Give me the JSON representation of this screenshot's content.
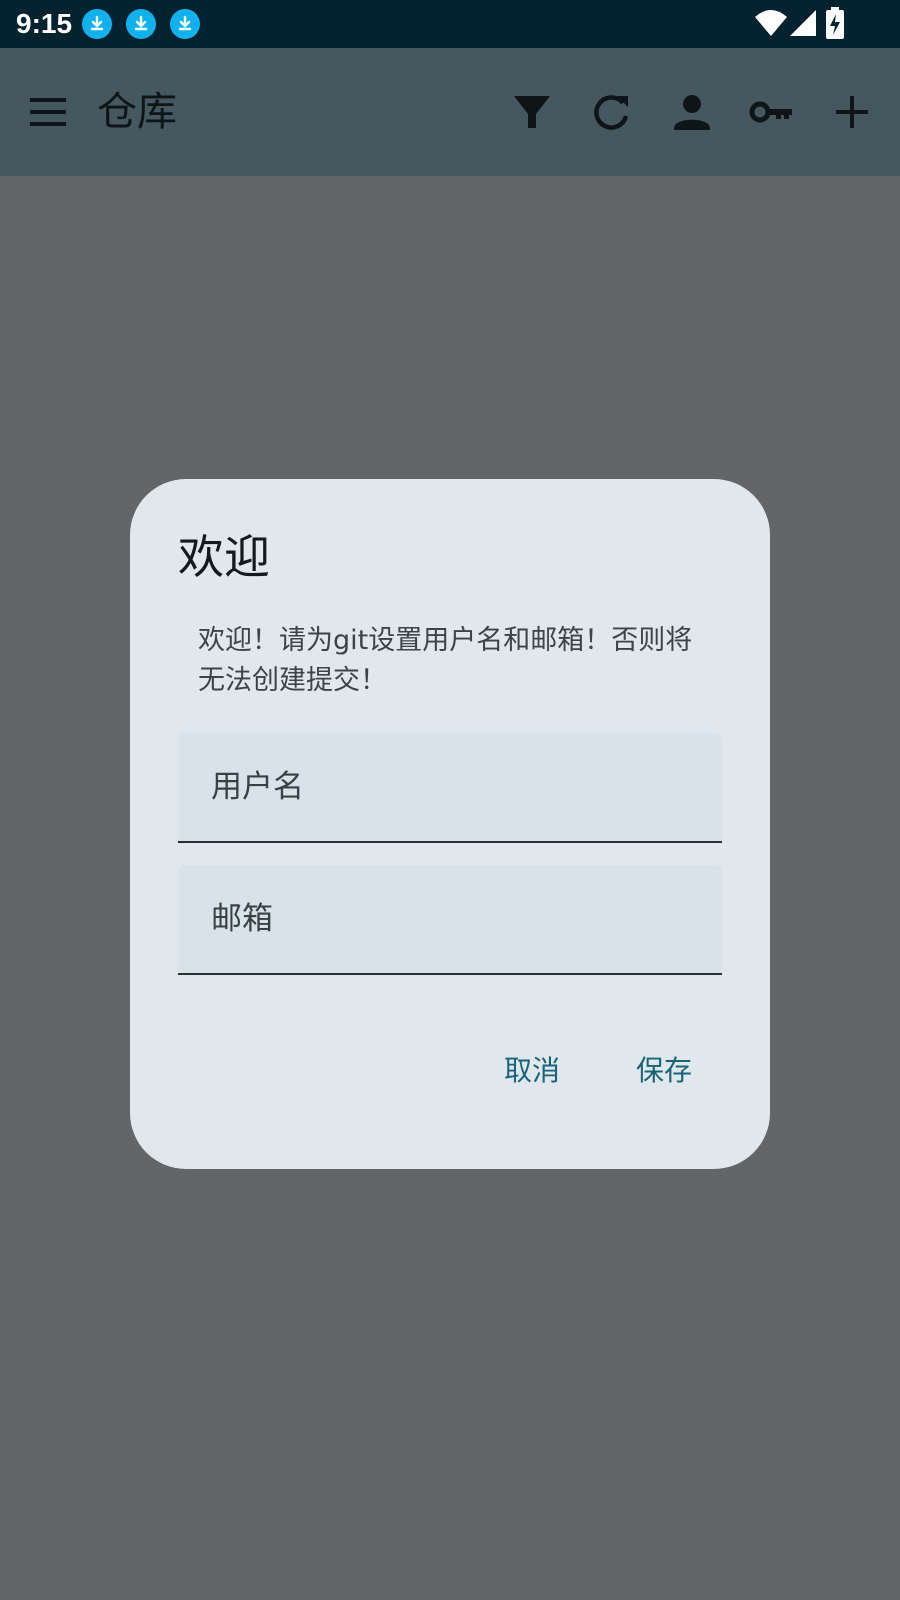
{
  "status_bar": {
    "time": "9:15",
    "notification_icons": [
      "download-icon",
      "download-icon",
      "download-icon"
    ],
    "system_icons": [
      "wifi-icon",
      "cell-signal-icon",
      "battery-charging-icon"
    ]
  },
  "app_bar": {
    "menu_icon": "menu-icon",
    "title": "仓库",
    "actions": [
      "filter-icon",
      "refresh-icon",
      "person-icon",
      "key-icon",
      "add-icon"
    ]
  },
  "dialog": {
    "title": "欢迎",
    "message": "欢迎！请为git设置用户名和邮箱！否则将无法创建提交！",
    "username_field": {
      "label": "用户名",
      "value": ""
    },
    "email_field": {
      "label": "邮箱",
      "value": ""
    },
    "cancel_label": "取消",
    "save_label": "保存"
  },
  "colors": {
    "status_bar": "#00232f",
    "app_bar": "#45585f",
    "scrim_background": "#636669",
    "dialog_background": "#e0e8ed",
    "field_background": "#d9e2e8",
    "accent": "#176378",
    "notification_icon": "#0fb2ef"
  }
}
